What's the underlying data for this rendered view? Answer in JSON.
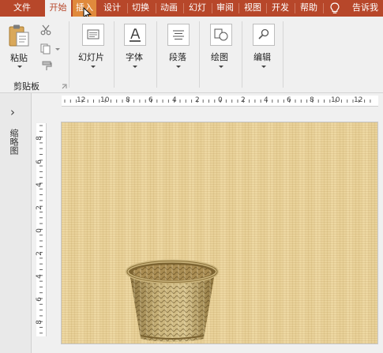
{
  "tabs": [
    "文件",
    "开始",
    "插入",
    "设计",
    "切换",
    "动画",
    "幻灯片",
    "审阅",
    "视图",
    "开发工",
    "帮助"
  ],
  "tab_labels_visible": [
    "文件",
    "开始",
    "插入",
    "设计",
    "切换",
    "动画",
    "幻灯",
    "审阅",
    "视图",
    "开发",
    "帮助"
  ],
  "active_tab": "开始",
  "hover_tab": "插入",
  "tell_me": "告诉我",
  "ribbon": {
    "paste": "粘贴",
    "clipboard_group": "剪贴板",
    "slides": "幻灯片",
    "font": "字体",
    "paragraph": "段落",
    "drawing": "绘图",
    "editing": "编辑"
  },
  "rail": {
    "collapse_glyph": "›",
    "thumbnail_label": "缩略图"
  },
  "hruler_labels": [
    "12",
    "10",
    "8",
    "6",
    "4",
    "2",
    "0",
    "2",
    "4",
    "6",
    "8",
    "10",
    "12"
  ],
  "vruler_labels": [
    "8",
    "6",
    "4",
    "2",
    "0",
    "2",
    "4",
    "6",
    "8"
  ],
  "colors": {
    "accent": "#b7472a",
    "hover": "#e08a3c",
    "slide_background": "#e9d29a"
  }
}
